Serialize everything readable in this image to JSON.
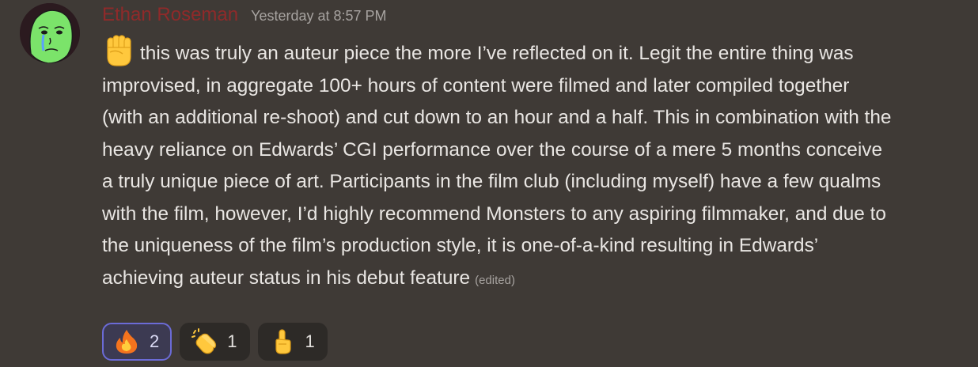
{
  "message": {
    "username": "Ethan Roseman",
    "timestamp": "Yesterday at 8:57 PM",
    "lead_emoji": "raised-fist",
    "text": "this was truly an auteur piece the more I’ve reflected on it. Legit the entire thing was improvised, in aggregate 100+ hours of content were filmed and later compiled together (with an additional re-shoot) and cut down to an hour and a half. This in combination with the heavy reliance on Edwards’ CGI performance over the course of a mere 5 months conceive a truly unique piece of art. Participants in the film club (including myself) have a few qualms with the film, however, I’d highly recommend Monsters to any aspiring filmmaker, and due to the uniqueness of the film’s production style, it is one-of-a-kind resulting in Edwards’ achieving auteur status in his debut feature",
    "edited_label": "(edited)"
  },
  "reactions": [
    {
      "emoji": "fire",
      "count": "2",
      "active": true
    },
    {
      "emoji": "clapping-hands",
      "count": "1",
      "active": false
    },
    {
      "emoji": "index-pointing-up",
      "count": "1",
      "active": false
    }
  ],
  "colors": {
    "background": "#3f3a36",
    "username": "#8f2a2a",
    "active_reaction_border": "#6b6bd6"
  }
}
